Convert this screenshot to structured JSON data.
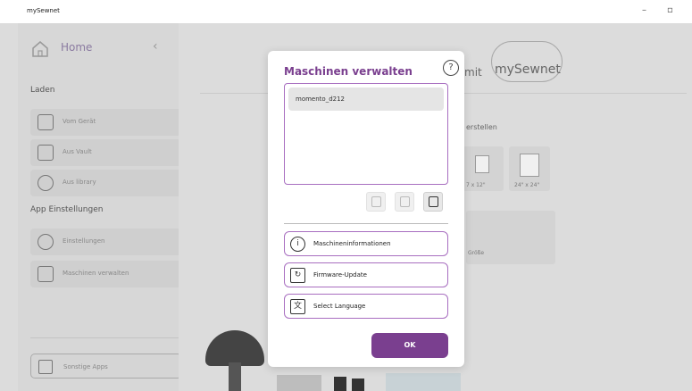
{
  "window": {
    "title": "mySewnet",
    "minimize": "–",
    "maximize": "▫"
  },
  "sidebar": {
    "home_label": "Home",
    "back_glyph": "‹",
    "section_laden": "Laden",
    "items_laden": [
      {
        "label": "Vom Gerät",
        "icon": "device-icon"
      },
      {
        "label": "Aus Vault",
        "icon": "vault-icon"
      },
      {
        "label": "Aus library",
        "icon": "library-icon"
      }
    ],
    "section_settings": "App Einstellungen",
    "items_settings": [
      {
        "label": "Einstellungen",
        "icon": "gear-icon"
      },
      {
        "label": "Maschinen verwalten",
        "icon": "machine-icon"
      }
    ],
    "other_apps_label": "Sonstige Apps"
  },
  "background": {
    "mit": "mit",
    "brand": "mySewnet",
    "create_label": "erstellen",
    "tile_labels": [
      "7 x 12\"",
      "24\" x 24\""
    ],
    "card_label": "Größe"
  },
  "dialog": {
    "title": "Maschinen verwalten",
    "help_glyph": "?",
    "machines": [
      "momento_d212"
    ],
    "buttons": [
      {
        "label": "Maschineninformationen",
        "glyph": "i"
      },
      {
        "label": "Firmware-Update",
        "glyph": "↻"
      },
      {
        "label": "Select Language",
        "glyph": "文"
      }
    ],
    "ok_label": "OK"
  },
  "colors": {
    "accent": "#7a3f8f",
    "border_accent": "#a86ec0"
  }
}
